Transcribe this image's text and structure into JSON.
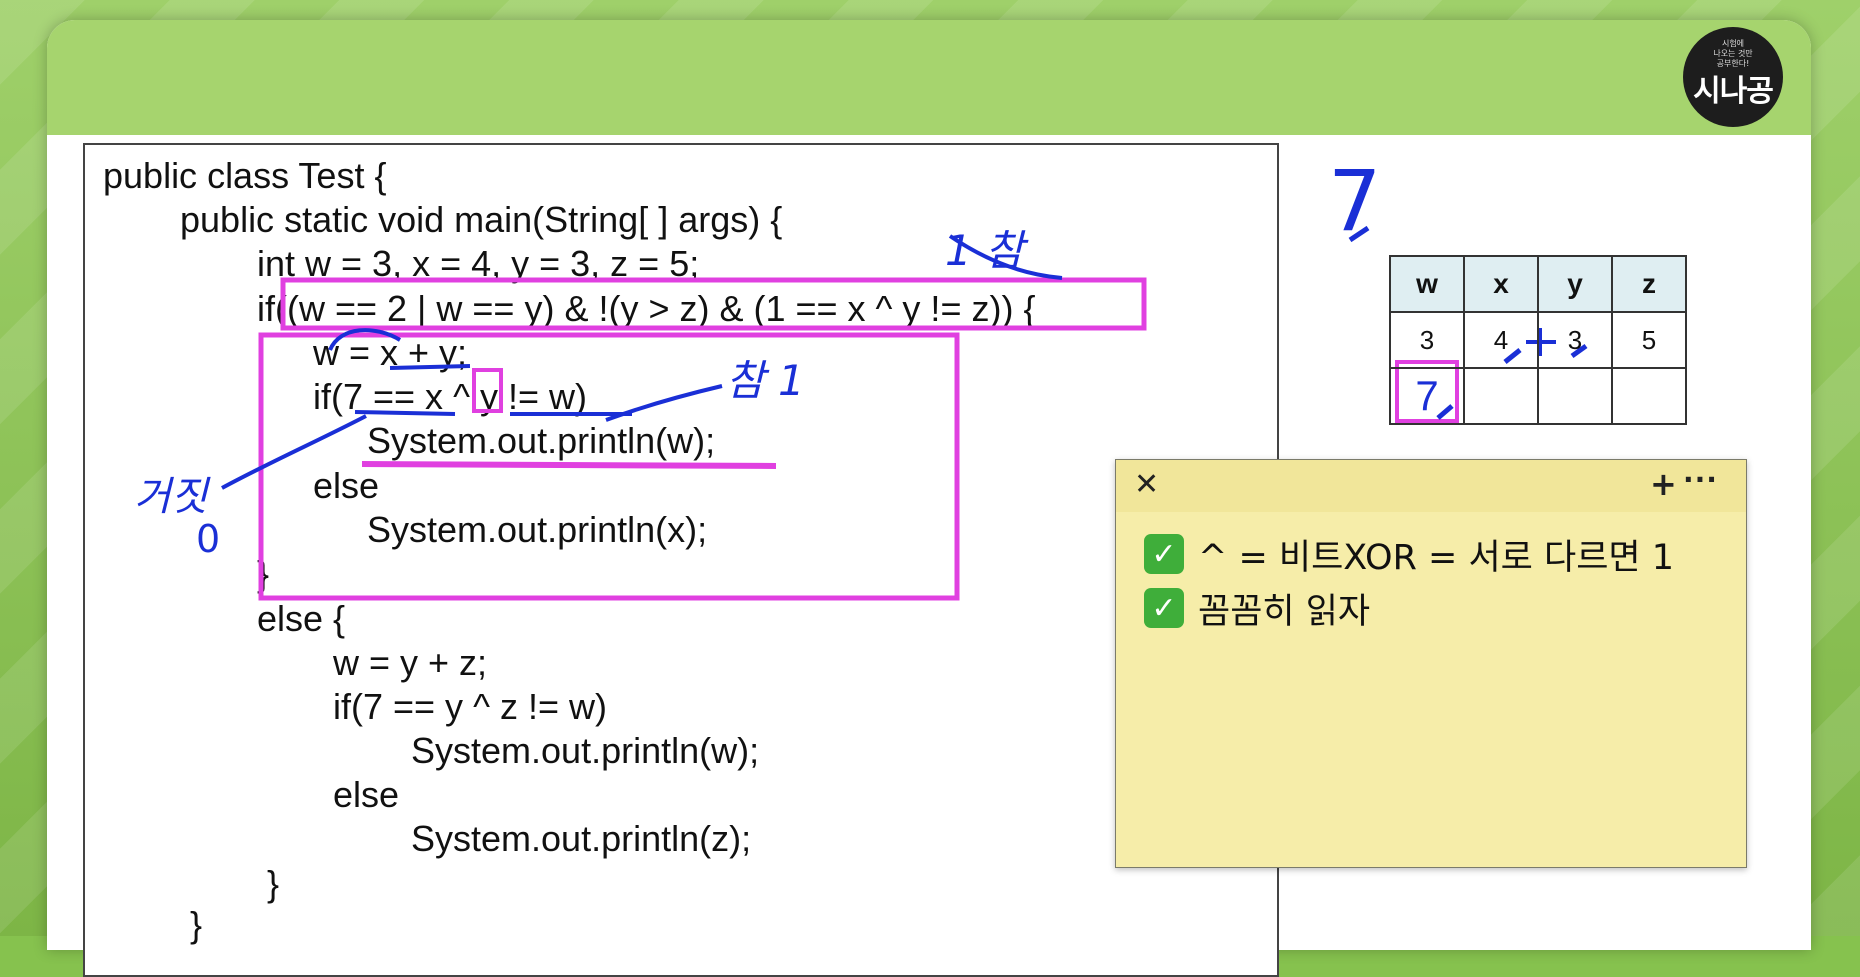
{
  "logo": {
    "small_text": "시험에\n나오는 것만\n공부한다!",
    "big_text": "시나공"
  },
  "code_lines": [
    "public class Test {",
    "public static void main(String[ ] args) {",
    "int w = 3, x = 4, y = 3, z = 5;",
    "if((w == 2 | w == y) & !(y > z) & (1 == x ^ y != z)) {",
    "w = x + y;",
    "if(7 == x ^ y != w)",
    "System.out.println(w);",
    "else",
    "System.out.println(x);",
    "}",
    "else {",
    "w = y + z;",
    "if(7 == y ^ z != w)",
    "System.out.println(w);",
    "else",
    "System.out.println(z);",
    "}",
    "}"
  ],
  "annotations": {
    "true_label_1": "1 참",
    "true_label_2": "참 1",
    "false_label": "거짓",
    "false_value": "0",
    "result_seven": "7"
  },
  "variable_table": {
    "headers": [
      "w",
      "x",
      "y",
      "z"
    ],
    "rows": [
      [
        "3",
        "4",
        "3",
        "5"
      ],
      [
        "7",
        "",
        "",
        ""
      ]
    ]
  },
  "sticky_note": {
    "close_icon": "✕",
    "add_icon": "+",
    "more_icon": "···",
    "check_icon": "✓",
    "items": [
      "^ = 비트XOR = 서로 다르면 1",
      "꼼꼼히 읽자"
    ]
  },
  "colors": {
    "background": "#86c24e",
    "header": "#a6d46e",
    "highlight": "#e040e0",
    "ink": "#1a2fd6",
    "sticky": "#f6eda9",
    "check": "#3fae3a"
  }
}
